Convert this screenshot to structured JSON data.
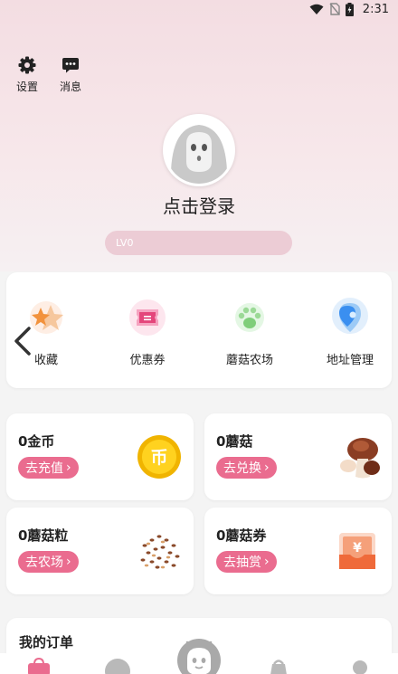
{
  "status": {
    "time": "2:31"
  },
  "top_actions": {
    "settings": "设置",
    "messages": "消息"
  },
  "profile": {
    "login": "点击登录",
    "level": "LV0"
  },
  "menu": [
    {
      "label": "收藏",
      "icon": "star-icon"
    },
    {
      "label": "优惠券",
      "icon": "coupon-icon"
    },
    {
      "label": "蘑菇农场",
      "icon": "paw-icon"
    },
    {
      "label": "地址管理",
      "icon": "location-pin-icon"
    }
  ],
  "stats": {
    "coins": {
      "title": "0金币",
      "button": "去充值",
      "icon": "coin-icon",
      "coin_text": "币"
    },
    "mushrooms": {
      "title": "0蘑菇",
      "button": "去兑换",
      "icon": "mushroom-icon"
    },
    "grains": {
      "title": "0蘑菇粒",
      "button": "去农场",
      "icon": "seeds-icon"
    },
    "vouchers": {
      "title": "0蘑菇券",
      "button": "去抽赏",
      "icon": "voucher-icon",
      "voucher_text": "¥"
    }
  },
  "orders": {
    "title": "我的订单"
  },
  "colors": {
    "accent": "#ea6c8f",
    "level_bar": "#ecccd5",
    "header_bg": "#f3dde2"
  }
}
